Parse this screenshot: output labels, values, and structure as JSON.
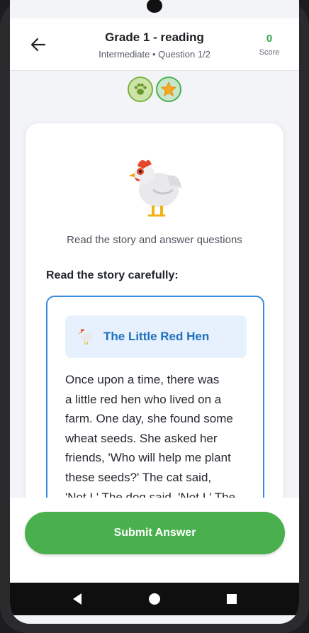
{
  "header": {
    "title": "Grade 1 - reading",
    "subtitle": "Intermediate • Question 1/2",
    "score_value": "0",
    "score_label": "Score",
    "back_icon": "arrow-left-icon"
  },
  "badges": [
    {
      "icon": "paw-icon",
      "color": "#7bb342"
    },
    {
      "icon": "star-icon",
      "color": "#f5a623"
    }
  ],
  "card": {
    "illustration": "hen-icon",
    "caption": "Read the story and answer questions",
    "section_title": "Read the story carefully:"
  },
  "story": {
    "icon": "hen-icon",
    "title": "The Little Red Hen",
    "lines": [
      "Once upon a time, there was",
      "a little red hen who lived on a",
      "farm. One day, she found some",
      "wheat seeds. She asked her",
      "friends, 'Who will help me plant",
      "these seeds?' The cat said,",
      "'Not I.' The dog said, 'Not I.' The"
    ]
  },
  "actions": {
    "submit_label": "Submit Answer"
  },
  "colors": {
    "accent_green": "#49b04d",
    "story_blue": "#1e6fbf",
    "score_green": "#35a54a"
  },
  "system_nav": {
    "back_icon": "triangle-back-icon",
    "home_icon": "circle-home-icon",
    "recents_icon": "square-recents-icon"
  }
}
